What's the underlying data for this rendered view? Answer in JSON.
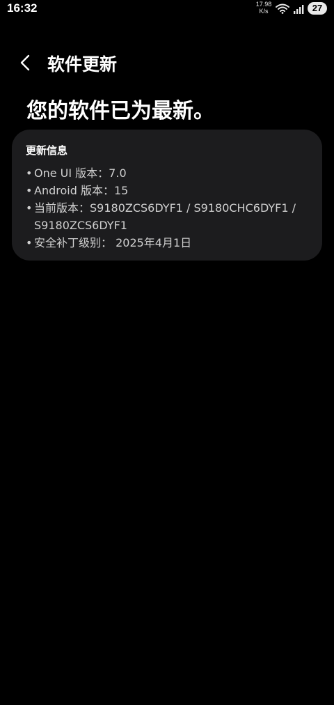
{
  "status_bar": {
    "time": "16:32",
    "net_speed_value": "17.98",
    "net_speed_unit": "K/s",
    "battery": "27",
    "icons": [
      "wifi-icon",
      "signal-icon"
    ]
  },
  "header": {
    "back_icon": "chevron-left-icon",
    "title": "软件更新"
  },
  "main": {
    "headline": "您的软件已为最新。",
    "card": {
      "heading": "更新信息",
      "bullet": "•",
      "items": [
        "One UI 版本：7.0",
        "Android 版本：15",
        "当前版本：S9180ZCS6DYF1 / S9180CHC6DYF1 /\nS9180ZCS6DYF1",
        "安全补丁级别： 2025年4月1日"
      ]
    }
  },
  "colors": {
    "background": "#000000",
    "card_background": "#1c1c1e",
    "text_primary": "#ffffff",
    "text_secondary": "#d0d0d0"
  }
}
